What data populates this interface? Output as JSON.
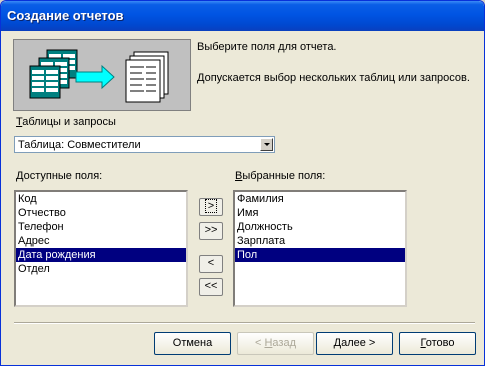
{
  "window": {
    "title": "Создание отчетов"
  },
  "intro": {
    "line1": "Выберите поля для отчета.",
    "line2": "Допускается выбор нескольких таблиц или запросов."
  },
  "source": {
    "label_u": "Т",
    "label_rest": "аблицы и запросы",
    "selected": "Таблица: Совместители"
  },
  "available": {
    "label_u": "Д",
    "label_rest": "оступные поля:",
    "items": [
      "Код",
      "Отчество",
      "Телефон",
      "Адрес",
      "Дата рождения",
      "Отдел"
    ],
    "selected_index": 4
  },
  "chosen": {
    "label_u": "В",
    "label_rest": "ыбранные поля:",
    "items": [
      "Фамилия",
      "Имя",
      "Должность",
      "Зарплата",
      "Пол"
    ],
    "selected_index": 4
  },
  "move_buttons": {
    "add": ">",
    "add_all": ">>",
    "remove": "<",
    "remove_all": "<<"
  },
  "footer": {
    "cancel": "Отмена",
    "back_prefix": "< ",
    "back_u": "Н",
    "back_rest": "азад",
    "next_u": "Д",
    "next_rest": "алее >",
    "finish_u": "Г",
    "finish_rest": "отово"
  }
}
